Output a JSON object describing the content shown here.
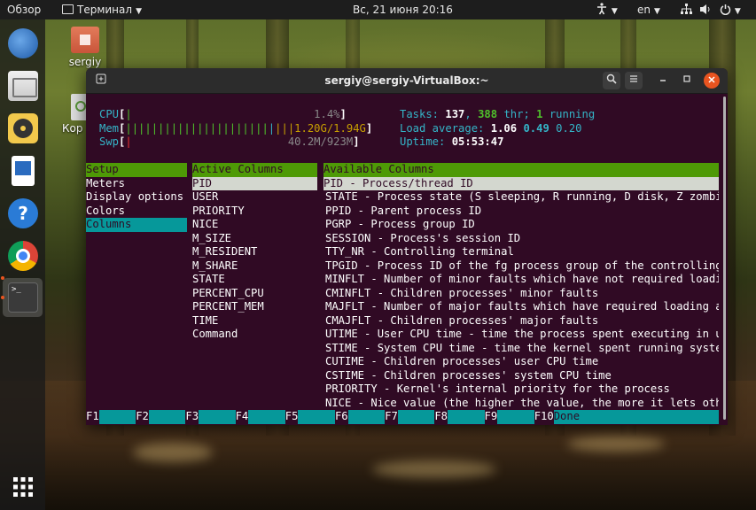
{
  "topbar": {
    "overview": "Обзор",
    "app_name": "Терминал",
    "clock": "Вс, 21 июня  20:16",
    "lang": "en"
  },
  "desktop": {
    "home_label": "sergiy",
    "trash_label": "Кор"
  },
  "window": {
    "title": "sergiy@sergiy-VirtualBox:~"
  },
  "meters": {
    "cpu_label": "CPU",
    "cpu_value": "1.4%",
    "mem_label": "Mem",
    "mem_value": "1.20G/1.94G",
    "swp_label": "Swp",
    "swp_value": "40.2M/923M",
    "tasks_label": "Tasks:",
    "tasks_count": "137",
    "threads_count": "388",
    "thr_label": "thr;",
    "running_count": "1",
    "running_label": "running",
    "load_label": "Load average:",
    "load_1": "1.06",
    "load_5": "0.49",
    "load_15": "0.20",
    "uptime_label": "Uptime:",
    "uptime_value": "05:53:47"
  },
  "setup": {
    "header": "Setup",
    "items": [
      "Meters",
      "Display options",
      "Colors",
      "Columns"
    ]
  },
  "active_columns": {
    "header": "Active Columns",
    "items": [
      "PID",
      "USER",
      "PRIORITY",
      "NICE",
      "M_SIZE",
      "M_RESIDENT",
      "M_SHARE",
      "STATE",
      "PERCENT_CPU",
      "PERCENT_MEM",
      "TIME",
      "Command"
    ]
  },
  "available_columns": {
    "header": "Available Columns",
    "items": [
      "PID - Process/thread ID",
      "STATE - Process state (S sleeping, R running, D disk, Z zombie,",
      "PPID - Parent process ID",
      "PGRP - Process group ID",
      "SESSION - Process's session ID",
      "TTY_NR - Controlling terminal",
      "TPGID - Process ID of the fg process group of the controlling t",
      "MINFLT - Number of minor faults which have not required loading",
      "CMINFLT - Children processes' minor faults",
      "MAJFLT - Number of major faults which have required loading a m",
      "CMAJFLT - Children processes' major faults",
      "UTIME - User CPU time - time the process spent executing in use",
      "STIME - System CPU time - time the kernel spent running system",
      "CUTIME - Children processes' user CPU time",
      "CSTIME - Children processes' system CPU time",
      "PRIORITY - Kernel's internal priority for the process",
      "NICE - Nice value (the higher the value, the more it lets other"
    ]
  },
  "function_keys": {
    "f1": "F1",
    "f2": "F2",
    "f3": "F3",
    "f4": "F4",
    "f5": "F5",
    "f6": "F6",
    "f7": "F7",
    "f8": "F8",
    "f9": "F9",
    "f10": "F10",
    "f10_label": "Done"
  },
  "colors": {
    "terminal_bg": "#300a24",
    "header_green": "#4e9a06",
    "selection_cyan": "#06989a",
    "meter_cyan": "#34b5c8"
  }
}
